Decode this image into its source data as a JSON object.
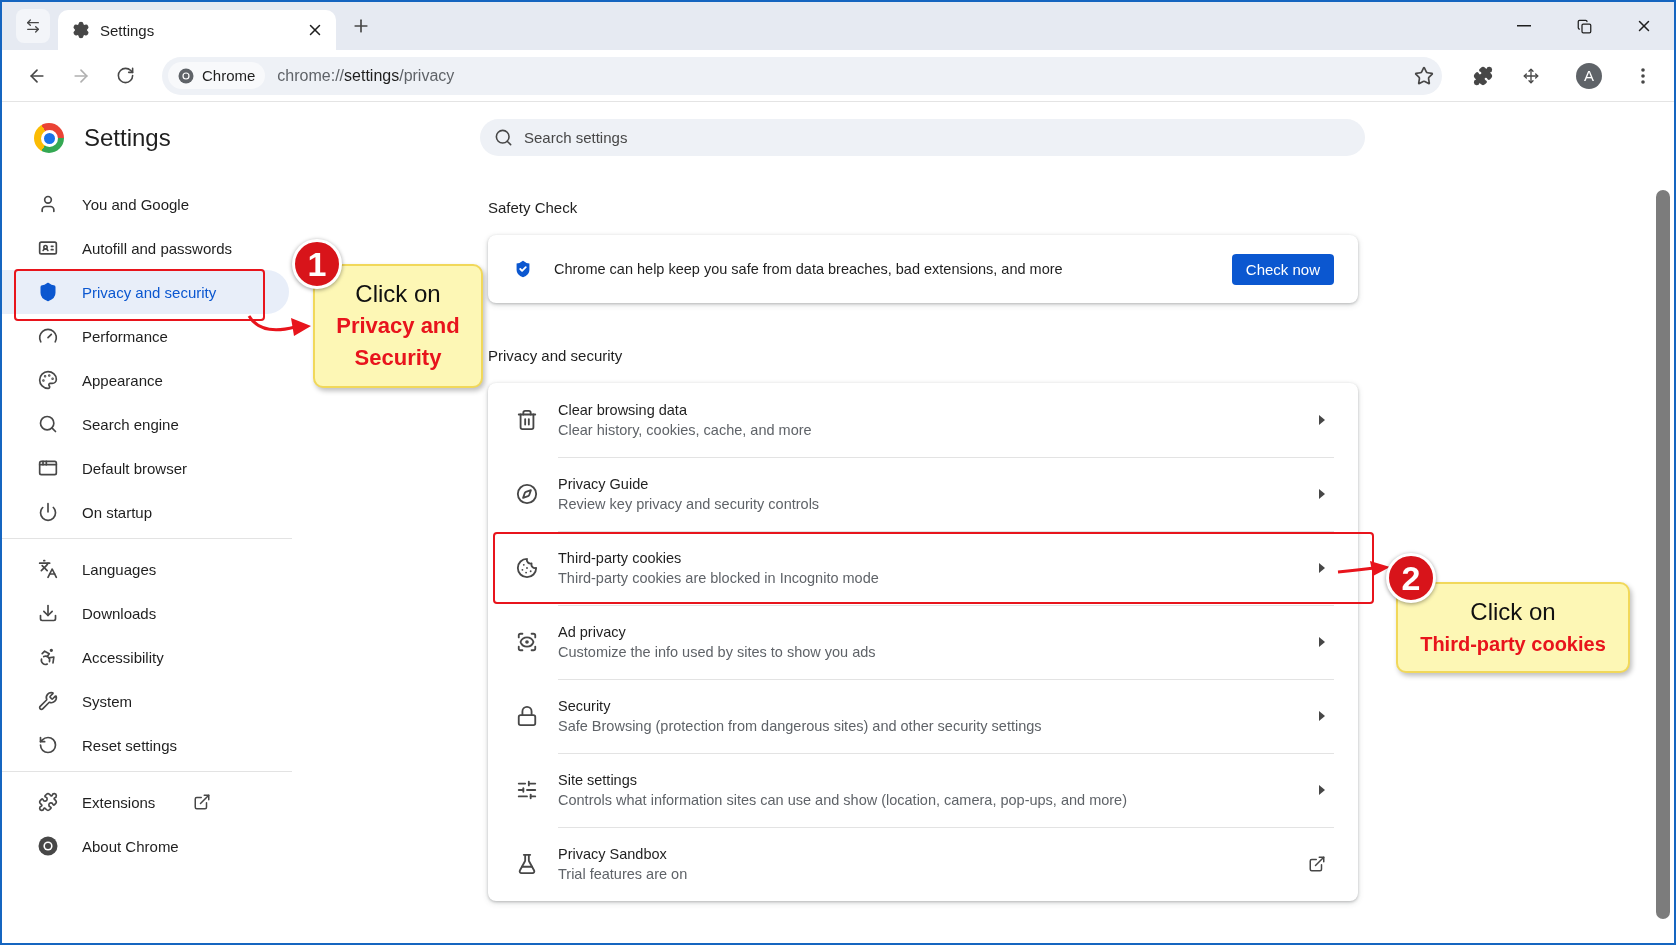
{
  "browser": {
    "tabs": [
      {
        "title": "Settings",
        "selected": true
      }
    ],
    "address_bar": {
      "chip": "Chrome",
      "url_scheme": "chrome://",
      "url_host": "settings",
      "url_path": "/privacy"
    },
    "profile_initial": "A"
  },
  "page": {
    "title": "Settings",
    "search": {
      "placeholder": "Search settings"
    }
  },
  "sidebar": {
    "groups": [
      {
        "items": [
          {
            "label": "You and Google",
            "selected": false,
            "highlighted": false,
            "external": false
          },
          {
            "label": "Autofill and passwords",
            "selected": false,
            "highlighted": false,
            "external": false
          },
          {
            "label": "Privacy and security",
            "selected": true,
            "highlighted": true,
            "external": false
          },
          {
            "label": "Performance",
            "selected": false,
            "highlighted": false,
            "external": false
          },
          {
            "label": "Appearance",
            "selected": false,
            "highlighted": false,
            "external": false
          },
          {
            "label": "Search engine",
            "selected": false,
            "highlighted": false,
            "external": false
          },
          {
            "label": "Default browser",
            "selected": false,
            "highlighted": false,
            "external": false
          },
          {
            "label": "On startup",
            "selected": false,
            "highlighted": false,
            "external": false
          }
        ]
      },
      {
        "items": [
          {
            "label": "Languages",
            "selected": false,
            "highlighted": false,
            "external": false
          },
          {
            "label": "Downloads",
            "selected": false,
            "highlighted": false,
            "external": false
          },
          {
            "label": "Accessibility",
            "selected": false,
            "highlighted": false,
            "external": false
          },
          {
            "label": "System",
            "selected": false,
            "highlighted": false,
            "external": false
          },
          {
            "label": "Reset settings",
            "selected": false,
            "highlighted": false,
            "external": false
          }
        ]
      },
      {
        "items": [
          {
            "label": "Extensions",
            "selected": false,
            "highlighted": false,
            "external": true
          },
          {
            "label": "About Chrome",
            "selected": false,
            "highlighted": false,
            "external": false
          }
        ]
      }
    ]
  },
  "sections": [
    {
      "kind": "safety",
      "heading": "Safety Check",
      "text": "Chrome can help keep you safe from data breaches, bad extensions, and more",
      "button": "Check now"
    },
    {
      "kind": "list",
      "heading": "Privacy and security",
      "rows": [
        {
          "title": "Clear browsing data",
          "subtitle": "Clear history, cookies, cache, and more",
          "kind": "submenu",
          "highlighted": false
        },
        {
          "title": "Privacy Guide",
          "subtitle": "Review key privacy and security controls",
          "kind": "submenu",
          "highlighted": false
        },
        {
          "title": "Third-party cookies",
          "subtitle": "Third-party cookies are blocked in Incognito mode",
          "kind": "submenu",
          "highlighted": true
        },
        {
          "title": "Ad privacy",
          "subtitle": "Customize the info used by sites to show you ads",
          "kind": "submenu",
          "highlighted": false
        },
        {
          "title": "Security",
          "subtitle": "Safe Browsing (protection from dangerous sites) and other security settings",
          "kind": "submenu",
          "highlighted": false
        },
        {
          "title": "Site settings",
          "subtitle": "Controls what information sites can use and show (location, camera, pop-ups, and more)",
          "kind": "submenu",
          "highlighted": false
        },
        {
          "title": "Privacy Sandbox",
          "subtitle": "Trial features are on",
          "kind": "external",
          "highlighted": false
        }
      ]
    }
  ],
  "annotations": [
    {
      "number": "1",
      "line1": "Click on",
      "line2": "Privacy and Security"
    },
    {
      "number": "2",
      "line1": "Click on",
      "line2": "Third-party cookies"
    }
  ]
}
